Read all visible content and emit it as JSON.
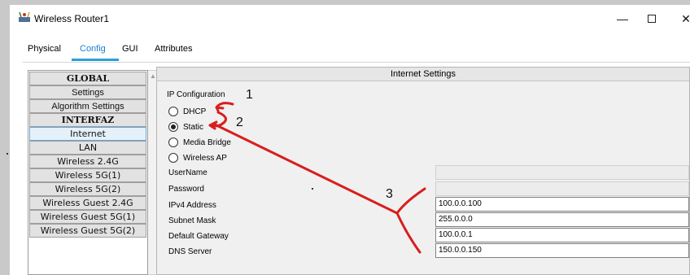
{
  "window": {
    "title": "Wireless Router1",
    "minimize_glyph": "—",
    "close_glyph": "✕"
  },
  "tabs": [
    {
      "label": "Physical"
    },
    {
      "label": "Config"
    },
    {
      "label": "GUI"
    },
    {
      "label": "Attributes"
    }
  ],
  "sidebar": {
    "items": [
      {
        "label": "GLOBAL",
        "kind": "header"
      },
      {
        "label": "Settings",
        "kind": "plain"
      },
      {
        "label": "Algorithm Settings",
        "kind": "plain"
      },
      {
        "label": "INTERFAZ",
        "kind": "header"
      },
      {
        "label": "Internet",
        "kind": "selected"
      },
      {
        "label": "LAN",
        "kind": "item"
      },
      {
        "label": "Wireless 2.4G",
        "kind": "item"
      },
      {
        "label": "Wireless 5G(1)",
        "kind": "item"
      },
      {
        "label": "Wireless 5G(2)",
        "kind": "item"
      },
      {
        "label": "Wireless Guest 2.4G",
        "kind": "item"
      },
      {
        "label": "Wireless Guest 5G(1)",
        "kind": "item"
      },
      {
        "label": "Wireless Guest 5G(2)",
        "kind": "item"
      }
    ]
  },
  "settings": {
    "section_title": "Internet Settings",
    "ip_configuration_label": "IP Configuration",
    "options": [
      {
        "label": "DHCP",
        "checked": false
      },
      {
        "label": "Static",
        "checked": true
      },
      {
        "label": "Media Bridge",
        "checked": false
      },
      {
        "label": "Wireless AP",
        "checked": false
      }
    ],
    "fields": [
      {
        "label": "UserName",
        "value": "",
        "enabled": false
      },
      {
        "label": "Password",
        "value": "",
        "enabled": false
      },
      {
        "label": "IPv4 Address",
        "value": "100.0.0.100",
        "enabled": true
      },
      {
        "label": "Subnet Mask",
        "value": "255.0.0.0",
        "enabled": true
      },
      {
        "label": "Default Gateway",
        "value": "100.0.0.1",
        "enabled": true
      },
      {
        "label": "DNS Server",
        "value": "150.0.0.150",
        "enabled": true
      }
    ]
  },
  "annotations": {
    "step1": "1",
    "step2": "2",
    "step3": "3",
    "color": "#d81e1e"
  }
}
